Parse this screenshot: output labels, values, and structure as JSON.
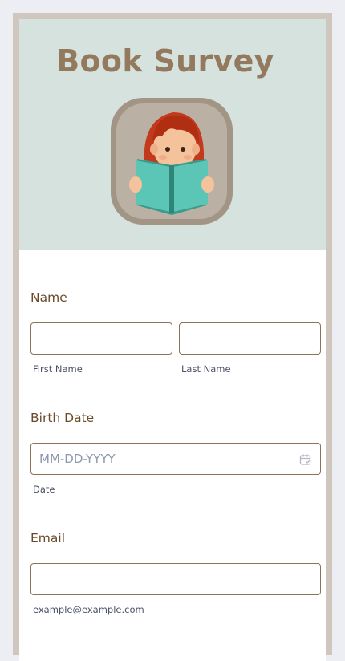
{
  "header": {
    "title": "Book Survey",
    "illustration": "girl-reading-book-icon"
  },
  "form": {
    "name": {
      "label": "Name",
      "first": {
        "value": "",
        "sublabel": "First Name"
      },
      "last": {
        "value": "",
        "sublabel": "Last Name"
      }
    },
    "birth_date": {
      "label": "Birth Date",
      "placeholder": "MM-DD-YYYY",
      "sublabel": "Date",
      "icon": "calendar-icon"
    },
    "email": {
      "label": "Email",
      "value": "",
      "sublabel": "example@example.com"
    }
  },
  "colors": {
    "page_bg": "#eceef3",
    "frame": "#cfc6bd",
    "header_bg": "#d6e2dd",
    "title": "#937a5e",
    "label": "#6b4a2b",
    "input_border": "#8c7257"
  }
}
